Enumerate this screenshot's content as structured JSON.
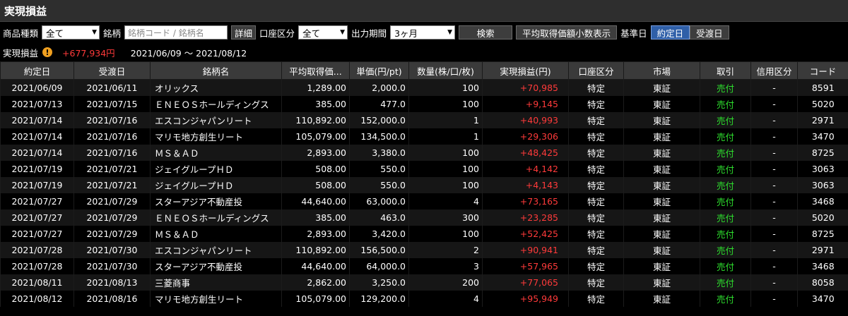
{
  "title": "実現損益",
  "filters": {
    "product_label": "商品種類",
    "product_value": "全て",
    "issue_label": "銘柄",
    "issue_placeholder": "銘柄コード / 銘柄名",
    "detail_button": "詳細",
    "account_label": "口座区分",
    "account_value": "全て",
    "period_label": "出力期間",
    "period_value": "3ヶ月",
    "search_button": "検索",
    "decimal_button": "平均取得価額小数表示",
    "basis_label": "基準日",
    "contract_date_button": "約定日",
    "delivery_date_button": "受渡日"
  },
  "summary": {
    "label": "実現損益",
    "total": "+677,934円",
    "period": "2021/06/09 ～ 2021/08/12"
  },
  "table": {
    "headers": [
      "約定日",
      "受渡日",
      "銘柄名",
      "平均取得価...",
      "単価(円/pt)",
      "数量(株/口/枚)",
      "実現損益(円)",
      "口座区分",
      "市場",
      "取引",
      "信用区分",
      "コード"
    ],
    "rows": [
      [
        "2021/06/09",
        "2021/06/11",
        "オリックス",
        "1,289.00",
        "2,000.0",
        "100",
        "+70,985",
        "特定",
        "東証",
        "売付",
        "-",
        "8591"
      ],
      [
        "2021/07/13",
        "2021/07/15",
        "ＥＮＥＯＳホールディングス",
        "385.00",
        "477.0",
        "100",
        "+9,145",
        "特定",
        "東証",
        "売付",
        "-",
        "5020"
      ],
      [
        "2021/07/14",
        "2021/07/16",
        "エスコンジャパンリート",
        "110,892.00",
        "152,000.0",
        "1",
        "+40,993",
        "特定",
        "東証",
        "売付",
        "-",
        "2971"
      ],
      [
        "2021/07/14",
        "2021/07/16",
        "マリモ地方創生リート",
        "105,079.00",
        "134,500.0",
        "1",
        "+29,306",
        "特定",
        "東証",
        "売付",
        "-",
        "3470"
      ],
      [
        "2021/07/14",
        "2021/07/16",
        "ＭＳ＆ＡＤ",
        "2,893.00",
        "3,380.0",
        "100",
        "+48,425",
        "特定",
        "東証",
        "売付",
        "-",
        "8725"
      ],
      [
        "2021/07/19",
        "2021/07/21",
        "ジェイグループＨＤ",
        "508.00",
        "550.0",
        "100",
        "+4,142",
        "特定",
        "東証",
        "売付",
        "-",
        "3063"
      ],
      [
        "2021/07/19",
        "2021/07/21",
        "ジェイグループＨＤ",
        "508.00",
        "550.0",
        "100",
        "+4,143",
        "特定",
        "東証",
        "売付",
        "-",
        "3063"
      ],
      [
        "2021/07/27",
        "2021/07/29",
        "スターアジア不動産投",
        "44,640.00",
        "63,000.0",
        "4",
        "+73,165",
        "特定",
        "東証",
        "売付",
        "-",
        "3468"
      ],
      [
        "2021/07/27",
        "2021/07/29",
        "ＥＮＥＯＳホールディングス",
        "385.00",
        "463.0",
        "300",
        "+23,285",
        "特定",
        "東証",
        "売付",
        "-",
        "5020"
      ],
      [
        "2021/07/27",
        "2021/07/29",
        "ＭＳ＆ＡＤ",
        "2,893.00",
        "3,420.0",
        "100",
        "+52,425",
        "特定",
        "東証",
        "売付",
        "-",
        "8725"
      ],
      [
        "2021/07/28",
        "2021/07/30",
        "エスコンジャパンリート",
        "110,892.00",
        "156,500.0",
        "2",
        "+90,941",
        "特定",
        "東証",
        "売付",
        "-",
        "2971"
      ],
      [
        "2021/07/28",
        "2021/07/30",
        "スターアジア不動産投",
        "44,640.00",
        "64,000.0",
        "3",
        "+57,965",
        "特定",
        "東証",
        "売付",
        "-",
        "3468"
      ],
      [
        "2021/08/11",
        "2021/08/13",
        "三菱商事",
        "2,862.00",
        "3,250.0",
        "200",
        "+77,065",
        "特定",
        "東証",
        "売付",
        "-",
        "8058"
      ],
      [
        "2021/08/12",
        "2021/08/16",
        "マリモ地方創生リート",
        "105,079.00",
        "129,200.0",
        "4",
        "+95,949",
        "特定",
        "東証",
        "売付",
        "-",
        "3470"
      ]
    ]
  },
  "colors": {
    "profit": "#ff3a3a",
    "sell": "#2ee02e",
    "active_button": "#2f5fa8"
  },
  "icons": {
    "warning": "warning-icon",
    "dropdown": "chevron-down-icon"
  }
}
